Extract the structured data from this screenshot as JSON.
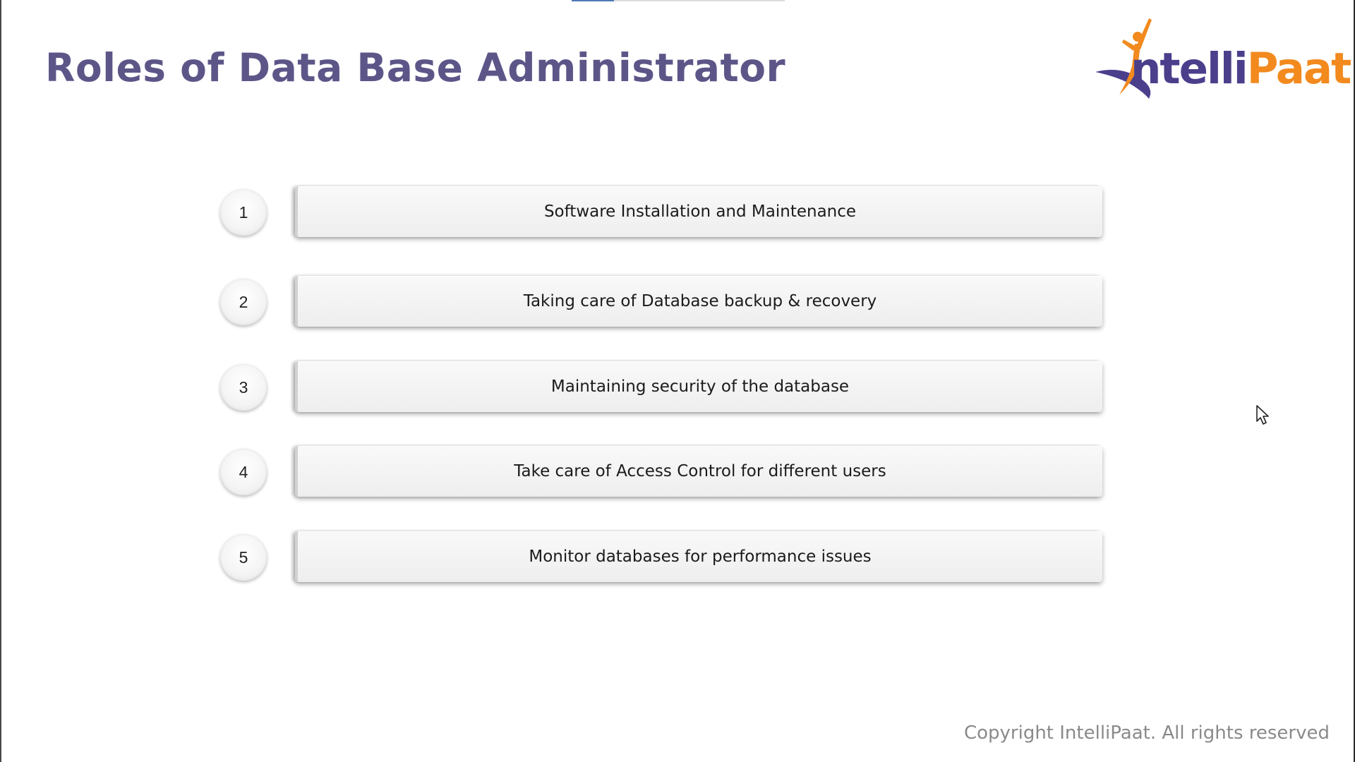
{
  "slide": {
    "title": "Roles of Data Base Administrator",
    "logo": {
      "text_primary": "ntelli",
      "text_secondary": "Paat",
      "icon": "intellipaat-figure-icon",
      "brand_purple": "#4b3f8c",
      "brand_orange": "#f28a1e"
    },
    "roles": [
      {
        "number": "1",
        "text": "Software Installation and Maintenance"
      },
      {
        "number": "2",
        "text": "Taking care of Database backup & recovery"
      },
      {
        "number": "3",
        "text": "Maintaining security of the database"
      },
      {
        "number": "4",
        "text": "Take care of Access Control for different users"
      },
      {
        "number": "5",
        "text": "Monitor databases for performance issues"
      }
    ],
    "copyright": "Copyright IntelliPaat. All rights reserved",
    "title_color": "#5c5688"
  },
  "video_progress": {
    "fraction": 0.2
  },
  "cursor": {
    "icon": "mouse-pointer-icon"
  }
}
